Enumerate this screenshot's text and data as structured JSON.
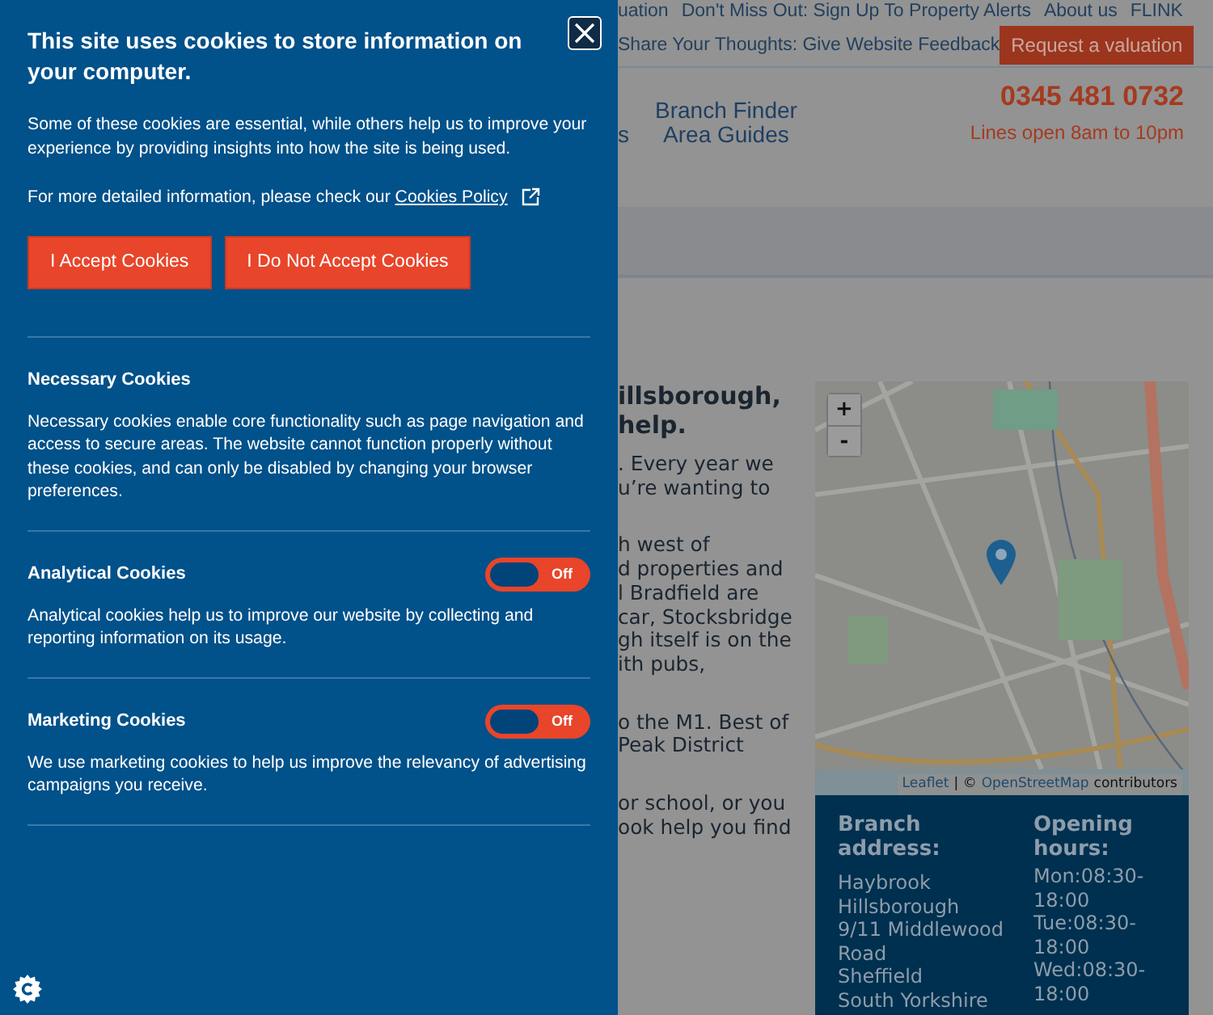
{
  "cookie_panel": {
    "title": "This site uses cookies to store information on your computer.",
    "intro": "Some of these cookies are essential, while others help us to improve your experience by providing insights into how the site is being used.",
    "policy_text": "For more detailed information, please check our ",
    "policy_link": "Cookies Policy",
    "buttons": [
      "I Accept Cookies",
      "I Do Not Accept Cookies"
    ],
    "sections": [
      {
        "kind": "text",
        "title": "Necessary Cookies",
        "description": "Necessary cookies enable core functionality such as page navigation and access to secure areas. The website cannot function properly without these cookies, and can only be disabled by changing your browser preferences."
      },
      {
        "kind": "toggle",
        "title": "Analytical Cookies",
        "toggle": {
          "on": false,
          "label": "Off"
        },
        "description": "Analytical cookies help us to improve our website by collecting and reporting information on its usage."
      },
      {
        "kind": "toggle",
        "title": "Marketing Cookies",
        "toggle": {
          "on": false,
          "label": "Off"
        },
        "description": "We use marketing cookies to help us improve the relevancy of advertising campaigns you receive."
      }
    ]
  },
  "background_page": {
    "top_links": [
      "uation",
      "Don't Miss Out: Sign Up To Property Alerts",
      "About us",
      "FLINK"
    ],
    "feedback_link": "Share Your Thoughts: Give Website Feedback",
    "valuation_button": "Request a valuation",
    "nav": [
      "s",
      "Branch Finder",
      "Area Guides"
    ],
    "phone": "0345 481 0732",
    "phone_hours": "Lines open 8am to 10pm",
    "heading_lines": [
      "illsborough,",
      "help."
    ],
    "paragraphs": [
      [
        ". Every year we",
        "u’re wanting to"
      ],
      [
        "h west of",
        "d properties and",
        "l Bradfield are",
        "car, Stocksbridge",
        "gh itself is on the",
        "ith pubs,"
      ],
      [
        "o the M1. Best of",
        "Peak District"
      ],
      [
        "or school, or you",
        "ook help you find"
      ]
    ],
    "map": {
      "zoom_in": "+",
      "zoom_out": "-",
      "attribution": [
        "Leaflet",
        "| ©",
        "OpenStreetMap",
        "contributors"
      ]
    },
    "branch": {
      "address_title": "Branch address:",
      "address_lines": [
        "Haybrook",
        "Hillsborough",
        "9/11 Middlewood",
        "Road",
        "Sheffield",
        "South Yorkshire"
      ],
      "hours_title": "Opening hours:",
      "hours_lines": [
        "Mon:08:30-18:00",
        "Tue:08:30-18:00",
        "Wed:08:30-18:00"
      ]
    }
  }
}
